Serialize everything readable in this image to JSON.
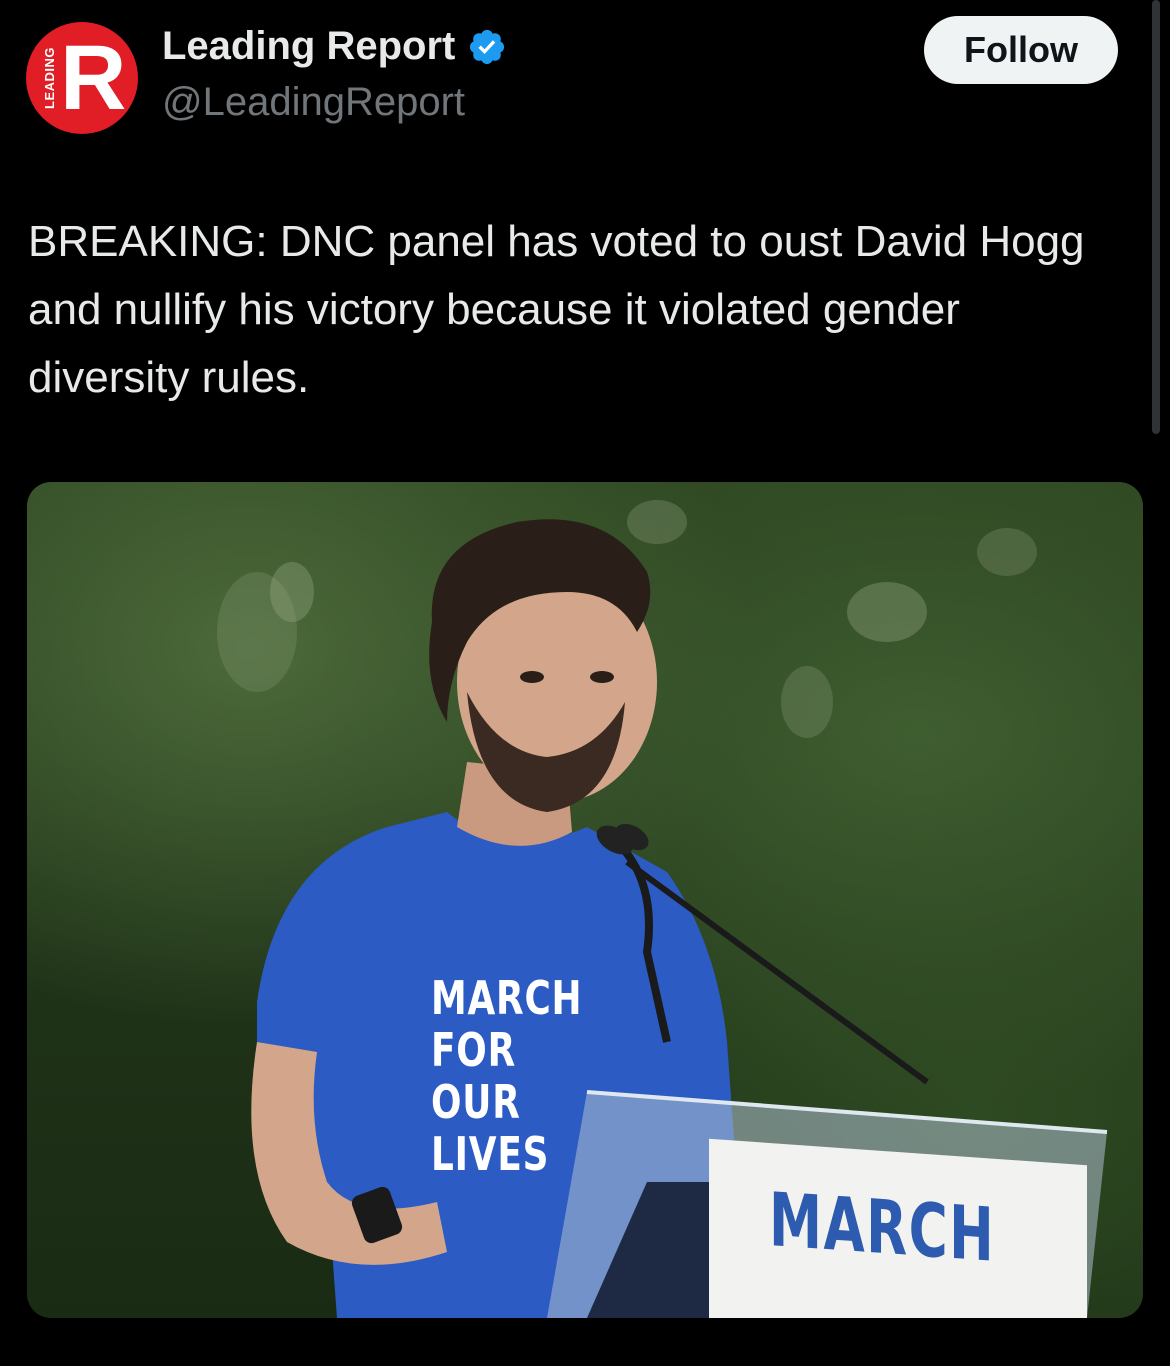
{
  "account": {
    "display_name": "Leading Report",
    "handle": "@LeadingReport",
    "verified": true,
    "avatar_letter": "R",
    "avatar_side_text": "LEADING"
  },
  "follow_button": {
    "label": "Follow"
  },
  "tweet": {
    "text": "BREAKING: DNC panel has voted to oust David Hogg and nullify his victory because it violated gender diversity rules."
  },
  "media": {
    "shirt_lines": [
      "MARCH",
      "FOR OUR",
      "LIVES"
    ],
    "sign_text": "MARCH"
  },
  "colors": {
    "background": "#000000",
    "text": "#e7e9ea",
    "secondary_text": "#71767b",
    "verified": "#1d9bf0",
    "avatar_red": "#e11d26",
    "follow_bg": "#eff3f4"
  }
}
